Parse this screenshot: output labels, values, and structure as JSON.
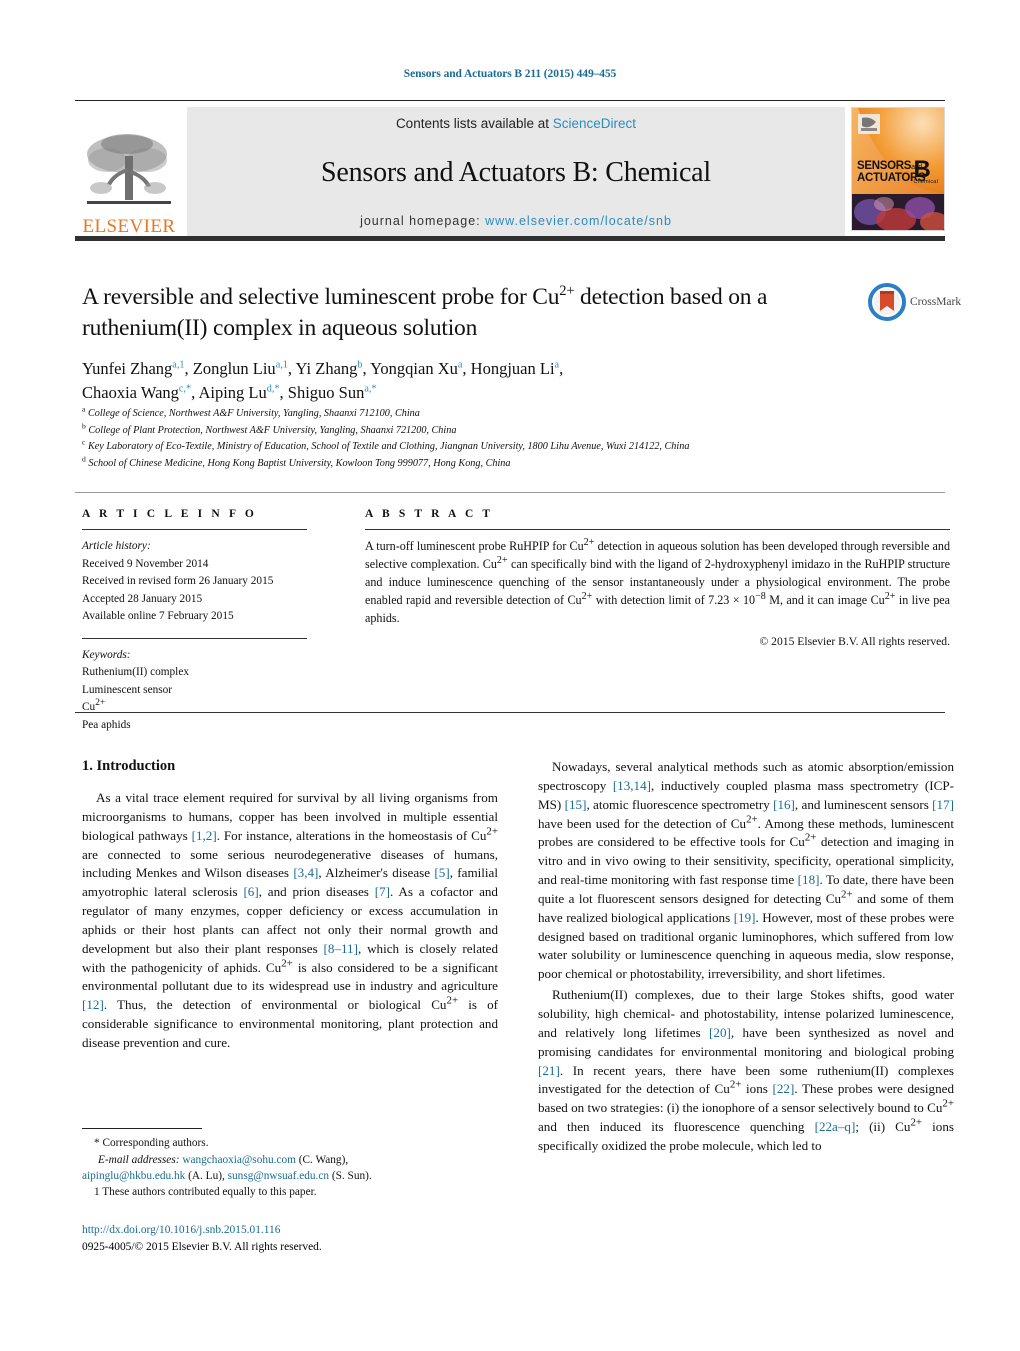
{
  "running_head": "Sensors and Actuators B 211 (2015) 449–455",
  "masthead": {
    "publisher_logo_label": "ELSEVIER",
    "contents_prefix": "Contents lists available at ",
    "contents_link": "ScienceDirect",
    "journal_name": "Sensors and Actuators B: Chemical",
    "homepage_prefix": "journal homepage: ",
    "homepage_url": "www.elsevier.com/locate/snb",
    "cover": {
      "line1": "SENSORS",
      "line1_small": "and",
      "line2": "ACTUATORS",
      "volume_letter": "B",
      "volume_sub": "Chemical"
    }
  },
  "title": "A reversible and selective luminescent probe for Cu2+ detection based on a ruthenium(II) complex in aqueous solution",
  "title_parts": {
    "before_sup": "A reversible and selective luminescent probe for Cu",
    "sup": "2+",
    "after_sup": " detection based on a ruthenium(II) complex in aqueous solution"
  },
  "crossmark": {
    "label": "CrossMark"
  },
  "authors": [
    {
      "name": "Yunfei Zhang",
      "marks": "a,1",
      "sep": ", "
    },
    {
      "name": "Zonglun Liu",
      "marks": "a,1",
      "sep": ", "
    },
    {
      "name": "Yi Zhang",
      "marks": "b",
      "sep": ", "
    },
    {
      "name": "Yongqian Xu",
      "marks": "a",
      "sep": ", "
    },
    {
      "name": "Hongjuan Li",
      "marks": "a",
      "sep": ", "
    },
    {
      "name": "Chaoxia Wang",
      "marks": "c,*",
      "sep": ", "
    },
    {
      "name": "Aiping Lu",
      "marks": "d,*",
      "sep": ", "
    },
    {
      "name": "Shiguo Sun",
      "marks": "a,*",
      "sep": ""
    }
  ],
  "affiliations": [
    {
      "mark": "a",
      "text": "College of Science, Northwest A&F University, Yangling, Shaanxi 712100, China"
    },
    {
      "mark": "b",
      "text": "College of Plant Protection, Northwest A&F University, Yangling, Shaanxi 721200, China"
    },
    {
      "mark": "c",
      "text": "Key Laboratory of Eco-Textile, Ministry of Education, School of Textile and Clothing, Jiangnan University, 1800 Lihu Avenue, Wuxi 214122, China"
    },
    {
      "mark": "d",
      "text": "School of Chinese Medicine, Hong Kong Baptist University, Kowloon Tong 999077, Hong Kong, China"
    }
  ],
  "article_info": {
    "heading": "A R T I C L E   I N F O",
    "history_label": "Article history:",
    "history": [
      "Received 9 November 2014",
      "Received in revised form 26 January 2015",
      "Accepted 28 January 2015",
      "Available online 7 February 2015"
    ],
    "keywords_label": "Keywords:",
    "keywords": [
      "Ruthenium(II) complex",
      "Luminescent sensor",
      "Cu2+",
      "Pea aphids"
    ]
  },
  "abstract": {
    "heading": "A B S T R A C T",
    "text": "A turn-off luminescent probe RuHPIP for Cu2+ detection in aqueous solution has been developed through reversible and selective complexation. Cu2+ can specifically bind with the ligand of 2-hydroxyphenyl imidazo in the RuHPIP structure and induce luminescence quenching of the sensor instantaneously under a physiological environment. The probe enabled rapid and reversible detection of Cu2+ with detection limit of 7.23 × 10−8 M, and it can image Cu2+ in live pea aphids.",
    "copyright": "© 2015 Elsevier B.V. All rights reserved."
  },
  "introduction": {
    "heading": "1.  Introduction",
    "left_paragraph": "As a vital trace element required for survival by all living organisms from microorganisms to humans, copper has been involved in multiple essential biological pathways [1,2]. For instance, alterations in the homeostasis of Cu2+ are connected to some serious neurodegenerative diseases of humans, including Menkes and Wilson diseases [3,4], Alzheimer's disease [5], familial amyotrophic lateral sclerosis [6], and prion diseases [7]. As a cofactor and regulator of many enzymes, copper deficiency or excess accumulation in aphids or their host plants can affect not only their normal growth and development but also their plant responses [8–11], which is closely related with the pathogenicity of aphids. Cu2+ is also considered to be a significant environmental pollutant due to its widespread use in industry and agriculture [12]. Thus, the detection of environmental or biological Cu2+ is of considerable significance to environmental monitoring, plant protection and disease prevention and cure.",
    "right_paragraph_1": "Nowadays, several analytical methods such as atomic absorption/emission spectroscopy [13,14], inductively coupled plasma mass spectrometry (ICP-MS) [15], atomic fluorescence spectrometry [16], and luminescent sensors [17] have been used for the detection of Cu2+. Among these methods, luminescent probes are considered to be effective tools for Cu2+ detection and imaging in vitro and in vivo owing to their sensitivity, specificity, operational simplicity, and real-time monitoring with fast response time [18]. To date, there have been quite a lot fluorescent sensors designed for detecting Cu2+ and some of them have realized biological applications [19]. However, most of these probes were designed based on traditional organic luminophores, which suffered from low water solubility or luminescence quenching in aqueous media, slow response, poor chemical or photostability, irreversibility, and short lifetimes.",
    "right_paragraph_2": "Ruthenium(II) complexes, due to their large Stokes shifts, good water solubility, high chemical- and photostability, intense polarized luminescence, and relatively long lifetimes [20], have been synthesized as novel and promising candidates for environmental monitoring and biological probing [21]. In recent years, there have been some ruthenium(II) complexes investigated for the detection of Cu2+ ions [22]. These probes were designed based on two strategies: (i) the ionophore of a sensor selectively bound to Cu2+ and then induced its fluorescence quenching [22a–q]; (ii) Cu2+ ions specifically oxidized the probe molecule, which led to"
  },
  "footnotes": {
    "corresponding": "* Corresponding authors.",
    "email_label": "E-mail addresses:",
    "emails": [
      {
        "addr": "wangchaoxia@sohu.com",
        "owner": " (C. Wang),"
      },
      {
        "addr": "aipinglu@hkbu.edu.hk",
        "owner": " (A. Lu),"
      },
      {
        "addr": "sunsg@nwsuaf.edu.cn",
        "owner": " (S. Sun)."
      }
    ],
    "equal_contrib": "1  These authors contributed equally to this paper."
  },
  "doi": "http://dx.doi.org/10.1016/j.snb.2015.01.116",
  "issn_line": "0925-4005/© 2015 Elsevier B.V. All rights reserved.",
  "colors": {
    "link_blue": "#1a6b96",
    "science_direct_blue": "#2b8cbe",
    "elsevier_orange": "#E87722",
    "band_gray": "#e8e8e8"
  }
}
